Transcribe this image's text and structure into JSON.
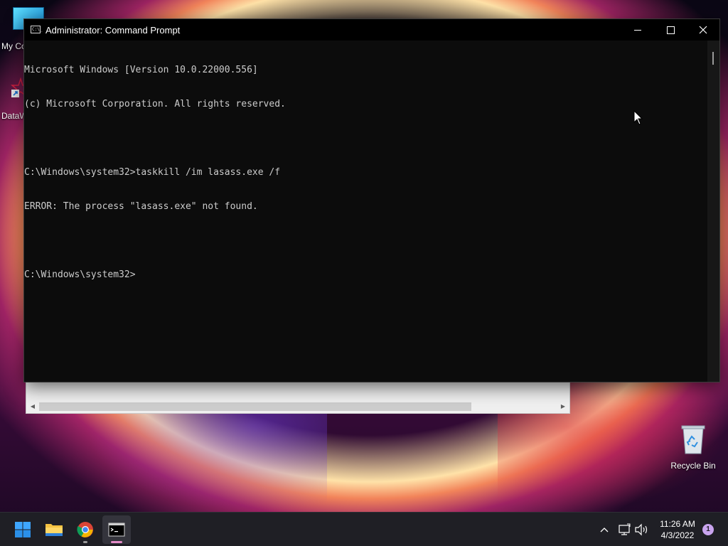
{
  "desktop": {
    "icons": [
      {
        "label": "My Co",
        "icon": "monitor-icon"
      },
      {
        "label": "DataW",
        "icon": "datawrapper-icon"
      },
      {
        "label": "Recycle Bin",
        "icon": "recycle-bin-icon"
      }
    ]
  },
  "cmd_window": {
    "title": "Administrator: Command Prompt",
    "title_icon": "C:\\_",
    "lines": [
      "Microsoft Windows [Version 10.0.22000.556]",
      "(c) Microsoft Corporation. All rights reserved.",
      "",
      "C:\\Windows\\system32>taskkill /im lasass.exe /f",
      "ERROR: The process \"lasass.exe\" not found.",
      "",
      "C:\\Windows\\system32>"
    ],
    "controls": {
      "minimize": "minimize-icon",
      "maximize": "maximize-icon",
      "close": "close-icon"
    }
  },
  "taskbar": {
    "apps": [
      {
        "name": "Start",
        "icon": "windows-start-icon"
      },
      {
        "name": "File Explorer",
        "icon": "folder-icon"
      },
      {
        "name": "Google Chrome",
        "icon": "chrome-icon"
      },
      {
        "name": "Command Prompt",
        "icon": "terminal-icon",
        "active": true
      }
    ],
    "tray": {
      "time": "11:26 AM",
      "date": "4/3/2022",
      "notification_count": "1"
    }
  },
  "colors": {
    "console_bg": "#0c0c0c",
    "console_text": "#cccccc",
    "taskbar_bg": "#1f1f25",
    "active_indicator": "#e48cc8"
  }
}
